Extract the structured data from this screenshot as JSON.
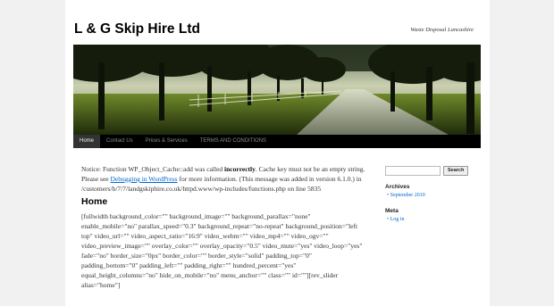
{
  "site": {
    "title": "L & G Skip Hire Ltd",
    "description": "Waste Disposal Lancashire"
  },
  "menu": {
    "items": [
      {
        "label": "Home"
      },
      {
        "label": "Contact Us"
      },
      {
        "label": "Prices & Services"
      },
      {
        "label": "TERMS AND CONDITIONS"
      }
    ]
  },
  "notice": {
    "prefix": "Notice: Function WP_Object_Cache::add was called ",
    "bold": "incorrectly",
    "middle": ". Cache key must not be an empty string. Please see ",
    "link": "Debugging in WordPress",
    "suffix": " for more information. (This message was added in version 6.1.0.) in /customers/b/7/7/landgskiphire.co.uk/httpd.www/wp-includes/functions.php on line 5835"
  },
  "entry": {
    "title": "Home",
    "content": "[fullwidth background_color=\"\" background_image=\"\" background_parallax=\"none\" enable_mobile=\"no\" parallax_speed=\"0.3\" background_repeat=\"no-repeat\" background_position=\"left top\" video_url=\"\" video_aspect_ratio=\"16:9\" video_webm=\"\" video_mp4=\"\" video_ogv=\"\" video_preview_image=\"\" overlay_color=\"\" overlay_opacity=\"0.5\" video_mute=\"yes\" video_loop=\"yes\" fade=\"no\" border_size=\"0px\" border_color=\"\" border_style=\"solid\" padding_top=\"0\" padding_bottom=\"0\" padding_left=\"\" padding_right=\"\" hundred_percent=\"yes\" equal_height_columns=\"no\" hide_on_mobile=\"no\" menu_anchor=\"\" class=\"\" id=\"\"][rev_slider alias=\"home\"]"
  },
  "sidebar": {
    "search_button": "Search",
    "search_value": "",
    "archives_title": "Archives",
    "archives": [
      {
        "label": "September 2010"
      }
    ],
    "meta_title": "Meta",
    "meta": [
      {
        "label": "Log in"
      }
    ]
  },
  "colors": {
    "background": "#f1f1f1",
    "menu_bar": "#000000",
    "link": "#0066cc"
  }
}
